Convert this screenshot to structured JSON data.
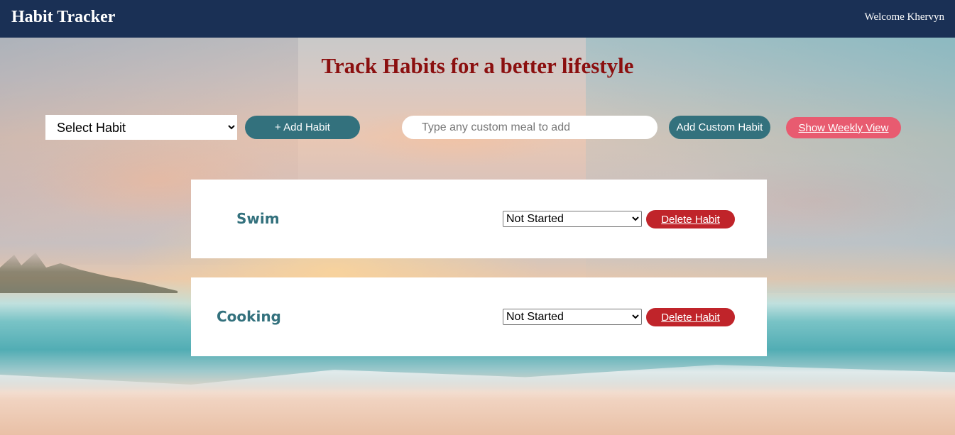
{
  "header": {
    "brand": "Habit Tracker",
    "welcome": "Welcome Khervyn"
  },
  "page": {
    "title": "Track Habits for a better lifestyle"
  },
  "controls": {
    "habit_select_value": "Select Habit",
    "add_habit_label": "+ Add Habit",
    "custom_placeholder": "Type any custom meal to add",
    "add_custom_label": "Add Custom Habit",
    "weekly_view_label": "Show Weekly View"
  },
  "habits": [
    {
      "name": "Swim",
      "status": "Not Started",
      "delete_label": "Delete Habit"
    },
    {
      "name": "Cooking",
      "status": "Not Started",
      "delete_label": "Delete Habit"
    }
  ],
  "colors": {
    "navbar": "#1a3055",
    "title": "#8b0f0f",
    "teal_button": "#33717d",
    "pink_button": "#e85b70",
    "delete_button": "#c0242a",
    "card_background": "#ffffff"
  },
  "icons": {
    "select_arrow": "chevron-down-icon"
  }
}
